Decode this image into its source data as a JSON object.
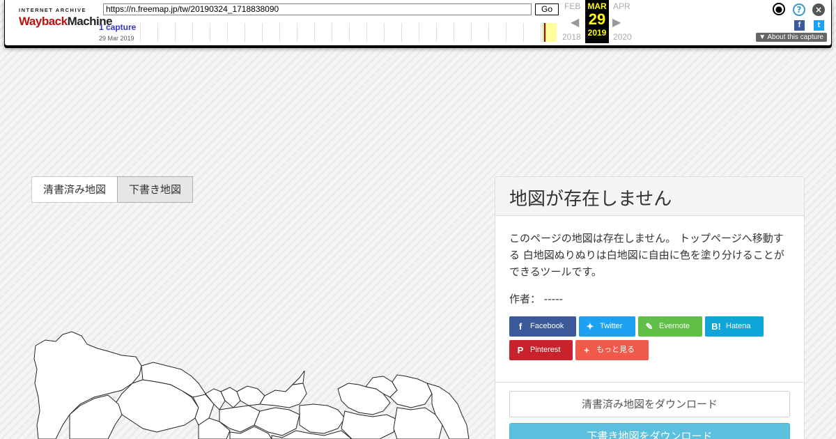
{
  "wayback": {
    "logo_top": "INTERNET ARCHIVE",
    "logo_main_a": "Wayback",
    "logo_main_b": "Machine",
    "url": "https://n.freemap.jp/tw/20190324_1718838090",
    "go_label": "Go",
    "captures": "1 capture",
    "capture_date": "29 Mar 2019",
    "prev_month": "FEB",
    "prev_year": "2018",
    "cur_month": "MAR",
    "cur_day": "29",
    "cur_year": "2019",
    "next_month": "APR",
    "next_year": "2020",
    "about_label": "About this capture"
  },
  "tabs": [
    {
      "label": "清書済み地図",
      "active": false
    },
    {
      "label": "下書き地図",
      "active": true
    }
  ],
  "panel": {
    "title": "地図が存在しません",
    "description": "このページの地図は存在しません。 トップページへ移動する 白地図ぬりぬりは白地図に自由に色を塗り分けることができるツールです。",
    "author_label": "作者：",
    "author_value": "-----",
    "share": [
      {
        "label": "Facebook",
        "color": "#3b5998",
        "icon": "facebook-icon"
      },
      {
        "label": "Twitter",
        "color": "#1da1f2",
        "icon": "twitter-icon"
      },
      {
        "label": "Evernote",
        "color": "#5fbf46",
        "icon": "evernote-icon"
      },
      {
        "label": "Hatena",
        "color": "#0fa5d8",
        "icon": "hatena-icon"
      },
      {
        "label": "Pinterest",
        "color": "#c8232c",
        "icon": "pinterest-icon"
      },
      {
        "label": "もっと見る",
        "color": "#f05a4b",
        "icon": "plus-icon"
      }
    ],
    "download_clean": "清書済み地図をダウンロード",
    "download_draft": "下書き地図をダウンロード"
  }
}
